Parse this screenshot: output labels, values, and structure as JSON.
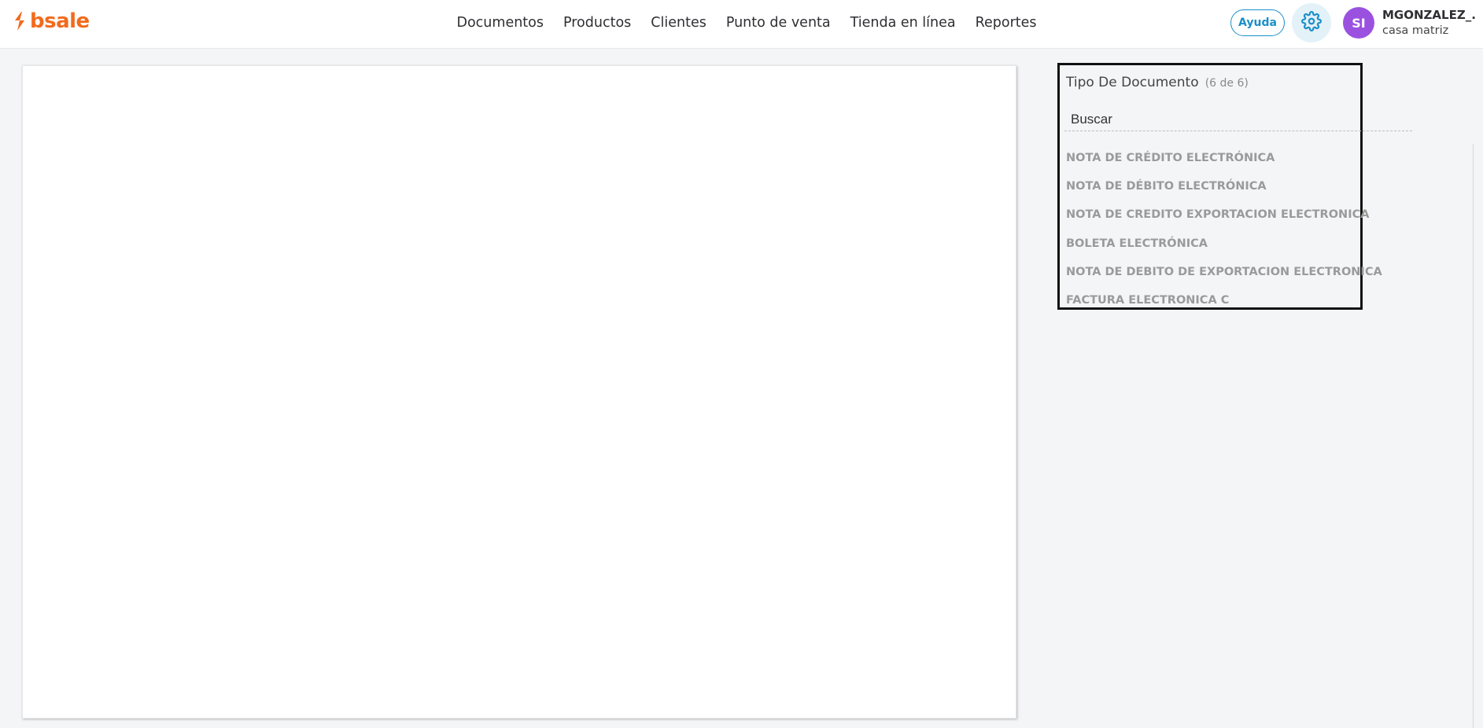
{
  "header": {
    "logo_text": "bsale",
    "nav": [
      {
        "label": "Documentos"
      },
      {
        "label": "Productos"
      },
      {
        "label": "Clientes"
      },
      {
        "label": "Punto de venta"
      },
      {
        "label": "Tienda en línea"
      },
      {
        "label": "Reportes"
      }
    ],
    "help_label": "Ayuda",
    "avatar_initials": "SI",
    "user_name": "MGONZALEZ_...",
    "user_branch": "casa matriz",
    "colors": {
      "brand": "#f26b1d",
      "accent": "#1a8fc9",
      "avatar": "#9b51e0"
    }
  },
  "filter": {
    "title": "Tipo De Documento",
    "count_label": "(6 de 6)",
    "search_placeholder": "Buscar",
    "items": [
      {
        "label": "NOTA DE CRÉDITO ELECTRÓNICA"
      },
      {
        "label": "NOTA DE DÉBITO ELECTRÓNICA"
      },
      {
        "label": "NOTA DE CREDITO EXPORTACION ELECTRONICA"
      },
      {
        "label": "BOLETA ELECTRÓNICA"
      },
      {
        "label": "NOTA DE DEBITO DE EXPORTACION ELECTRONICA"
      },
      {
        "label": "FACTURA ELECTRONICA C"
      }
    ]
  },
  "icons": {
    "logo": "bsale-logo-icon",
    "settings": "gear-icon"
  }
}
